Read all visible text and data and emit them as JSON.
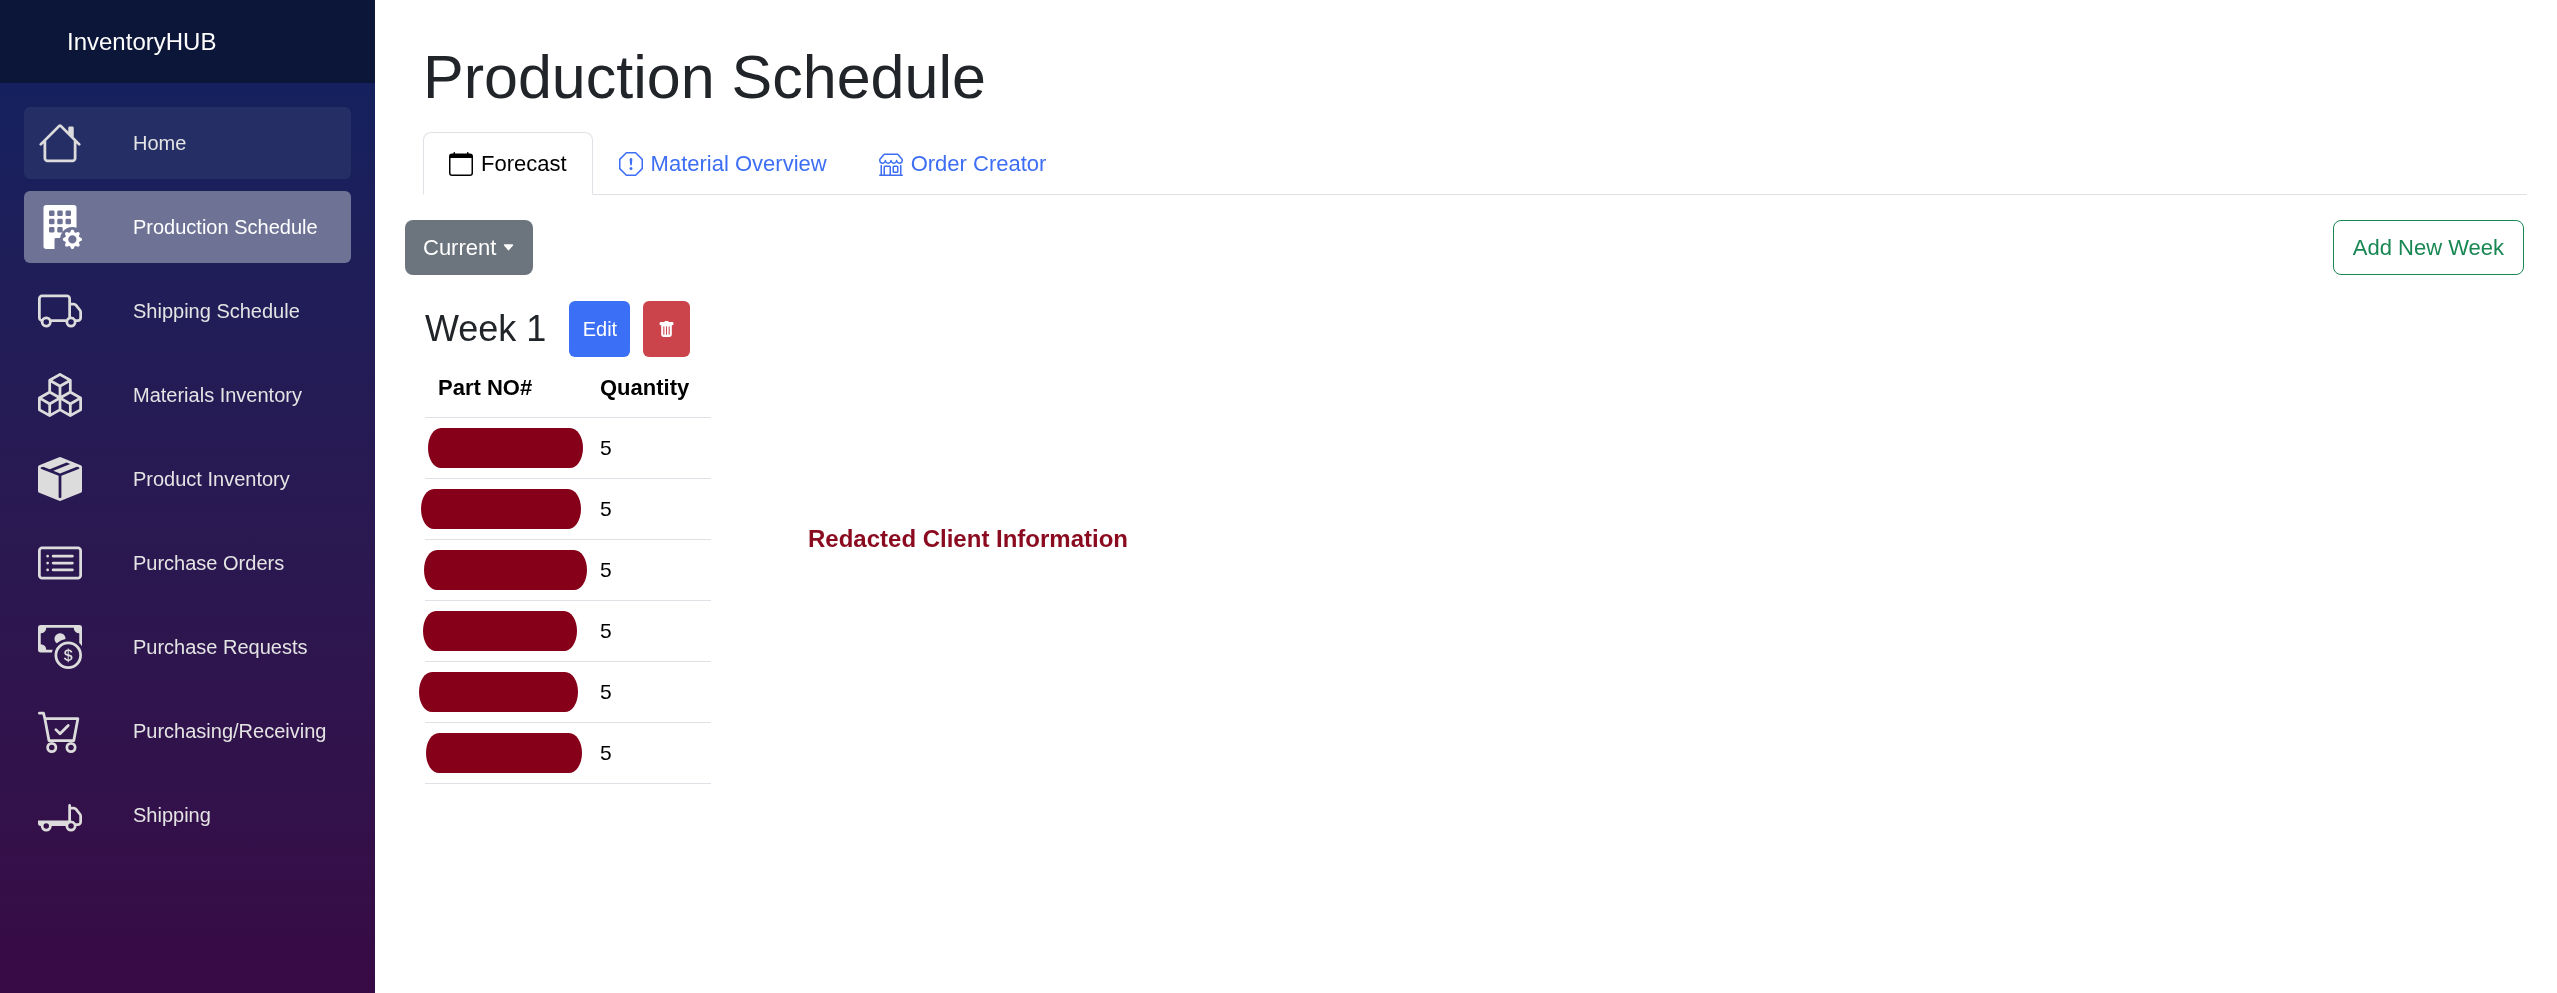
{
  "sidebar": {
    "brand": "InventoryHUB",
    "items": [
      {
        "label": "Home",
        "selected": false,
        "hovered": true
      },
      {
        "label": "Production Schedule",
        "selected": true,
        "hovered": false
      },
      {
        "label": "Shipping Schedule",
        "selected": false,
        "hovered": false
      },
      {
        "label": "Materials Inventory",
        "selected": false,
        "hovered": false
      },
      {
        "label": "Product Inventory",
        "selected": false,
        "hovered": false
      },
      {
        "label": "Purchase Orders",
        "selected": false,
        "hovered": false
      },
      {
        "label": "Purchase Requests",
        "selected": false,
        "hovered": false
      },
      {
        "label": "Purchasing/Receiving",
        "selected": false,
        "hovered": false
      },
      {
        "label": "Shipping",
        "selected": false,
        "hovered": false
      }
    ]
  },
  "page": {
    "title": "Production Schedule"
  },
  "tabs": [
    {
      "label": "Forecast",
      "selected": true
    },
    {
      "label": "Material Overview",
      "selected": false
    },
    {
      "label": "Order Creator",
      "selected": false
    }
  ],
  "toolbar": {
    "week_filter": "Current",
    "add_button": "Add New Week"
  },
  "weeks": [
    {
      "title": "Week 1",
      "edit_button": "Edit",
      "columns": [
        "Part NO#",
        "Quantity"
      ],
      "rows": [
        {
          "part_no_redacted": true,
          "quantity": "5"
        },
        {
          "part_no_redacted": true,
          "quantity": "5"
        },
        {
          "part_no_redacted": true,
          "quantity": "5"
        },
        {
          "part_no_redacted": true,
          "quantity": "5"
        },
        {
          "part_no_redacted": true,
          "quantity": "5"
        },
        {
          "part_no_redacted": true,
          "quantity": "5"
        }
      ]
    }
  ],
  "redaction_note": "Redacted Client Information"
}
